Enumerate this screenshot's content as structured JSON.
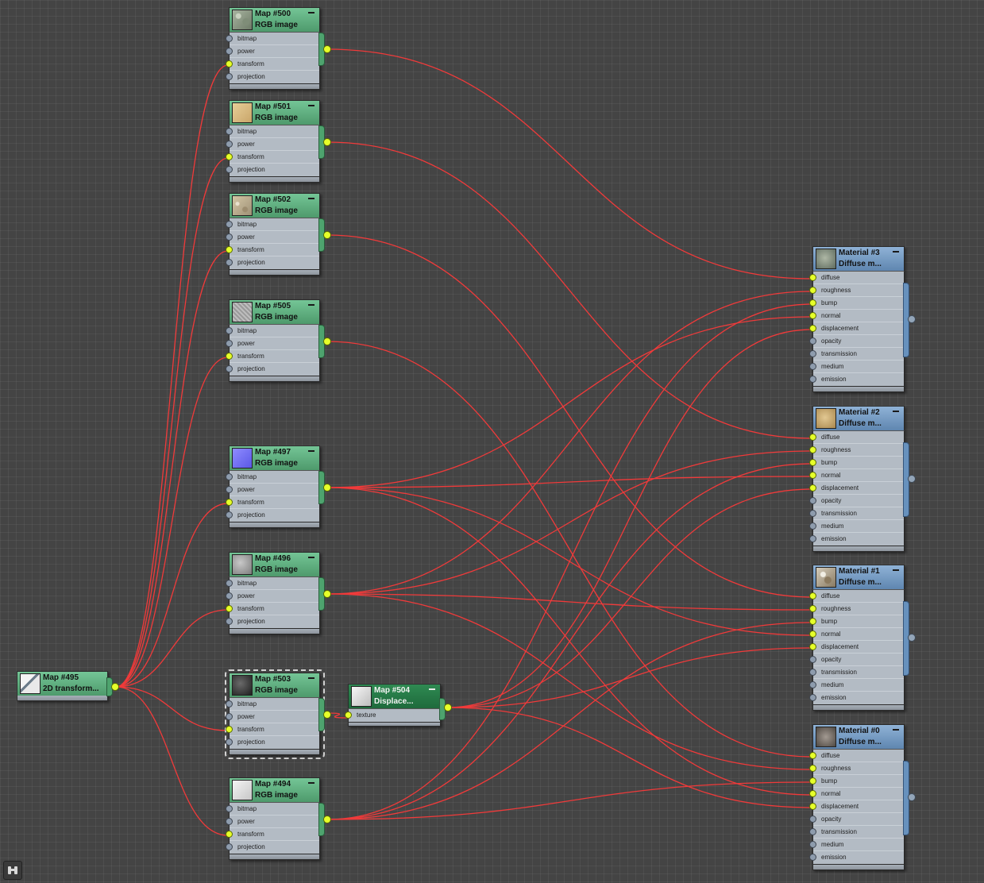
{
  "map_nodes": [
    {
      "title": "Map #500",
      "subtitle": "RGB image",
      "thumb": "mossy-texture-thumbnail"
    },
    {
      "title": "Map #501",
      "subtitle": "RGB image",
      "thumb": "sand-texture-thumbnail"
    },
    {
      "title": "Map #502",
      "subtitle": "RGB image",
      "thumb": "gravel-texture-thumbnail"
    },
    {
      "title": "Map #505",
      "subtitle": "RGB image",
      "thumb": "noise-texture-thumbnail"
    },
    {
      "title": "Map #497",
      "subtitle": "RGB image",
      "thumb": "normal-map-thumbnail"
    },
    {
      "title": "Map #496",
      "subtitle": "RGB image",
      "thumb": "grey-texture-thumbnail"
    },
    {
      "title": "Map #503",
      "subtitle": "RGB image",
      "thumb": "dark-texture-thumbnail"
    },
    {
      "title": "Map #494",
      "subtitle": "RGB image",
      "thumb": "white-texture-thumbnail"
    }
  ],
  "map_inputs": [
    "bitmap",
    "power",
    "transform",
    "projection"
  ],
  "transform_node": {
    "title": "Map #495",
    "subtitle": "2D transform..."
  },
  "displace_node": {
    "title": "Map #504",
    "subtitle": "Displace...",
    "input": "texture"
  },
  "material_nodes": [
    {
      "title": "Material #3",
      "subtitle": "Diffuse m..."
    },
    {
      "title": "Material #2",
      "subtitle": "Diffuse m..."
    },
    {
      "title": "Material #1",
      "subtitle": "Diffuse m..."
    },
    {
      "title": "Material #0",
      "subtitle": "Diffuse m..."
    }
  ],
  "material_inputs": [
    "diffuse",
    "roughness",
    "bump",
    "normal",
    "displacement",
    "opacity",
    "transmission",
    "medium",
    "emission"
  ],
  "colors": {
    "background": "#444444",
    "wire": "#f03a3a",
    "map_header": "#5fae7f",
    "material_header": "#7a9dc4",
    "displace_header": "#27784a",
    "socket_connected": "#e6ff2a",
    "socket_empty": "#8e9cad"
  }
}
